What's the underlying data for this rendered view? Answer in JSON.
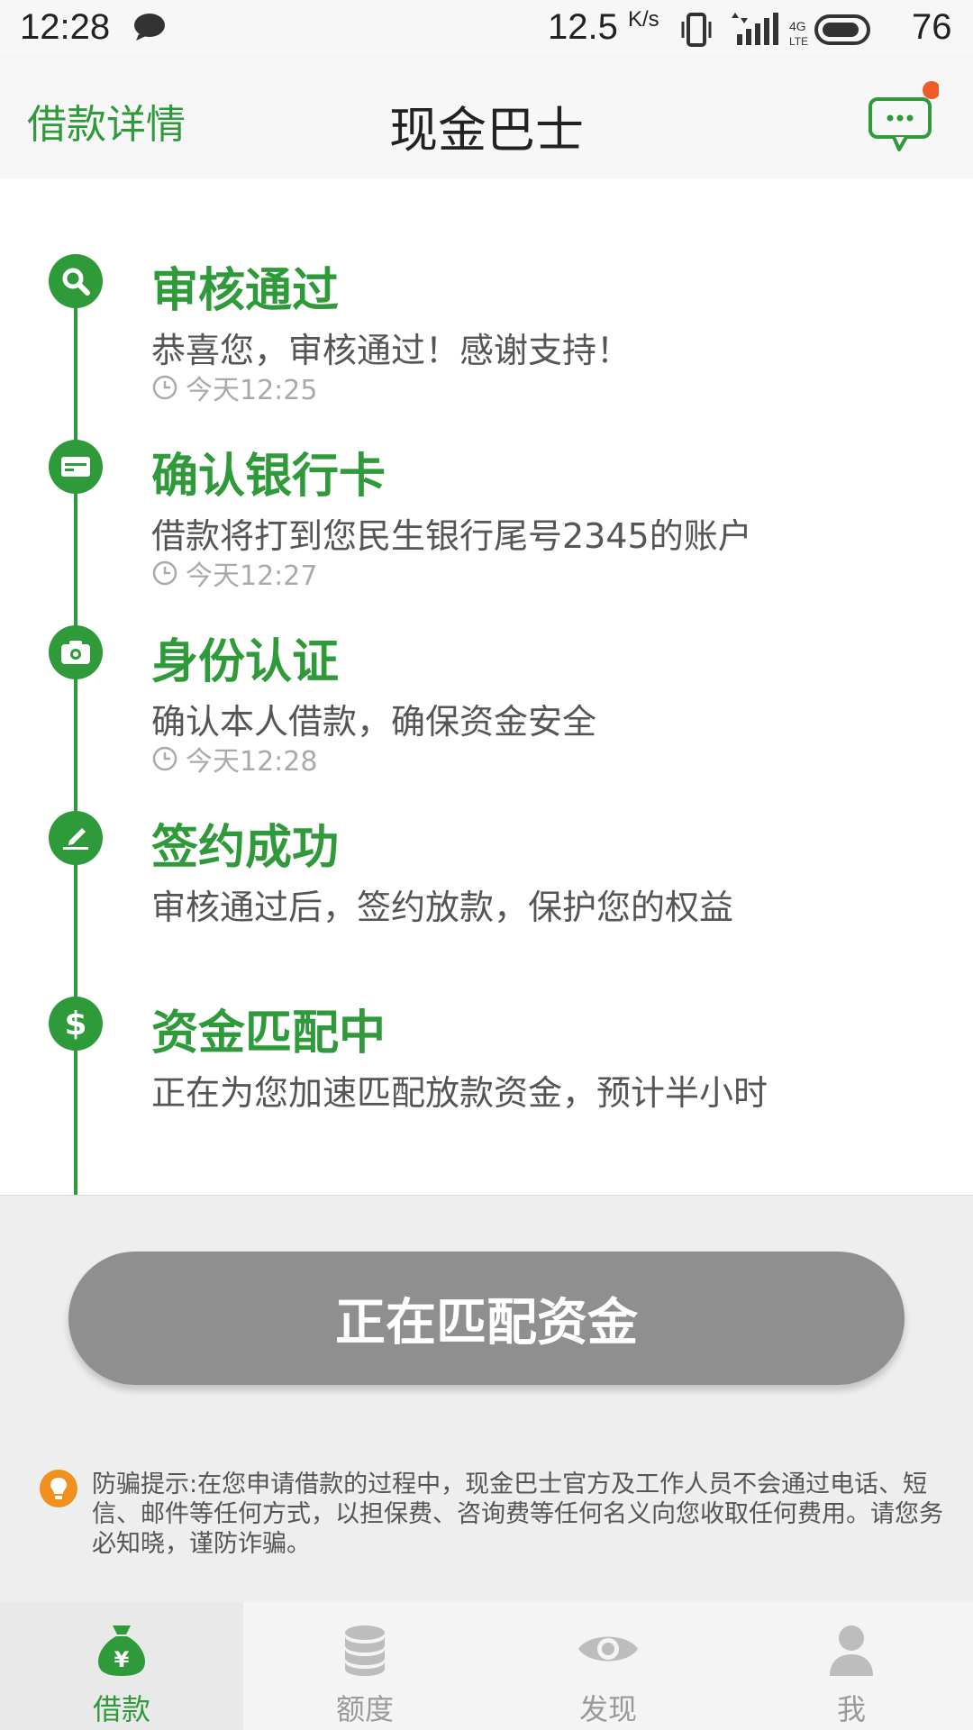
{
  "status_bar": {
    "time": "12:28",
    "speed_value": "12.5",
    "speed_unit": "K/s",
    "network": "4G",
    "battery": "76"
  },
  "header": {
    "back_label": "借款详情",
    "title": "现金巴士",
    "message_icon": "chat-bubble-icon"
  },
  "timeline": {
    "steps": [
      {
        "icon": "search-icon",
        "title": "审核通过",
        "desc": "恭喜您，审核通过！感谢支持！",
        "time": "今天12:25"
      },
      {
        "icon": "bank-card-icon",
        "title": "确认银行卡",
        "desc": "借款将打到您民生银行尾号2345的账户",
        "time": "今天12:27"
      },
      {
        "icon": "camera-icon",
        "title": "身份认证",
        "desc": "确认本人借款，确保资金安全",
        "time": "今天12:28"
      },
      {
        "icon": "sign-icon",
        "title": "签约成功",
        "desc": "审核通过后，签约放款，保护您的权益"
      },
      {
        "icon": "dollar-icon",
        "title": "资金匹配中",
        "desc": "正在为您加速匹配放款资金，预计半小时"
      }
    ]
  },
  "action": {
    "button_label": "正在匹配资金"
  },
  "notice": {
    "icon": "lightbulb-icon",
    "text": "防骗提示:在您申请借款的过程中，现金巴士官方及工作人员不会通过电话、短信、邮件等任何方式，以担保费、咨询费等任何名义向您收取任何费用。请您务必知晓，谨防诈骗。"
  },
  "tabs": [
    {
      "label": "借款",
      "icon": "money-bag-icon",
      "active": true
    },
    {
      "label": "额度",
      "icon": "coin-stack-icon",
      "active": false
    },
    {
      "label": "发现",
      "icon": "eye-icon",
      "active": false
    },
    {
      "label": "我",
      "icon": "person-icon",
      "active": false
    }
  ],
  "colors": {
    "accent": "#2f9a3a",
    "button_disabled": "#8f8f8f",
    "notice_icon": "#f0911f",
    "badge": "#f05a28"
  }
}
